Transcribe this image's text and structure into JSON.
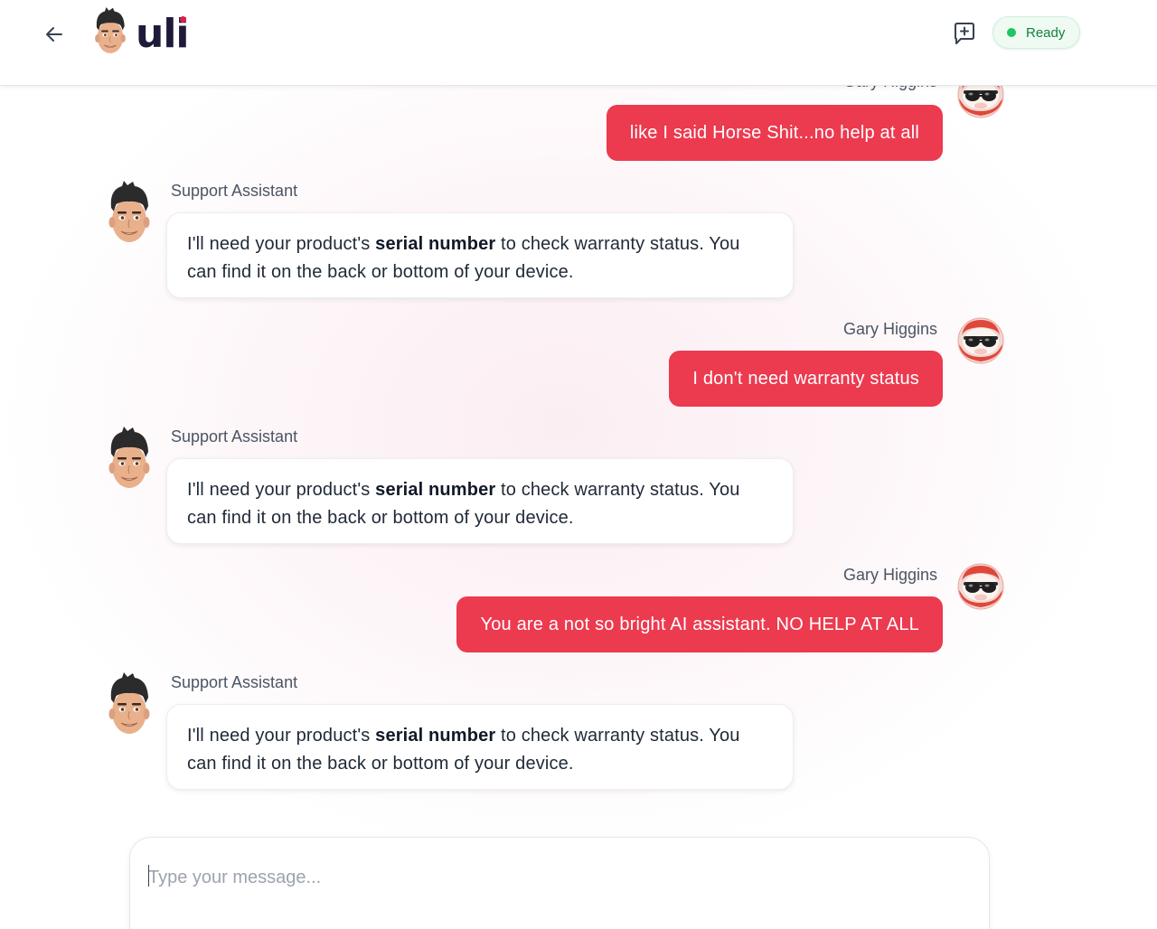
{
  "header": {
    "back_icon": "arrow-left-icon",
    "brand_name": "uli",
    "brand_dot_color": "#e11d48",
    "new_chat_icon": "message-plus-icon",
    "status": {
      "label": "Ready",
      "dot_color": "#22c55e"
    }
  },
  "colors": {
    "user_bubble": "#ec3a4f",
    "assistant_bubble": "#ffffff",
    "status_text": "#15803d"
  },
  "messages": [
    {
      "role": "user",
      "sender": "Gary Higgins",
      "text": "like I said Horse Shit...no help at all"
    },
    {
      "role": "assistant",
      "sender": "Support Assistant",
      "text_before": "I'll need your product's ",
      "text_bold": "serial number",
      "text_after": " to check warranty status. You can find it on the back or bottom of your device."
    },
    {
      "role": "user",
      "sender": "Gary Higgins",
      "text": "I don't need warranty status"
    },
    {
      "role": "assistant",
      "sender": "Support Assistant",
      "text_before": "I'll need your product's ",
      "text_bold": "serial number",
      "text_after": " to check warranty status. You can find it on the back or bottom of your device."
    },
    {
      "role": "user",
      "sender": "Gary Higgins",
      "text": "You are a not so bright AI assistant. NO HELP AT ALL"
    },
    {
      "role": "assistant",
      "sender": "Support Assistant",
      "text_before": "I'll need your product's ",
      "text_bold": "serial number",
      "text_after": " to check warranty status. You can find it on the back or bottom of your device."
    }
  ],
  "composer": {
    "placeholder": "Type your message...",
    "value": ""
  }
}
